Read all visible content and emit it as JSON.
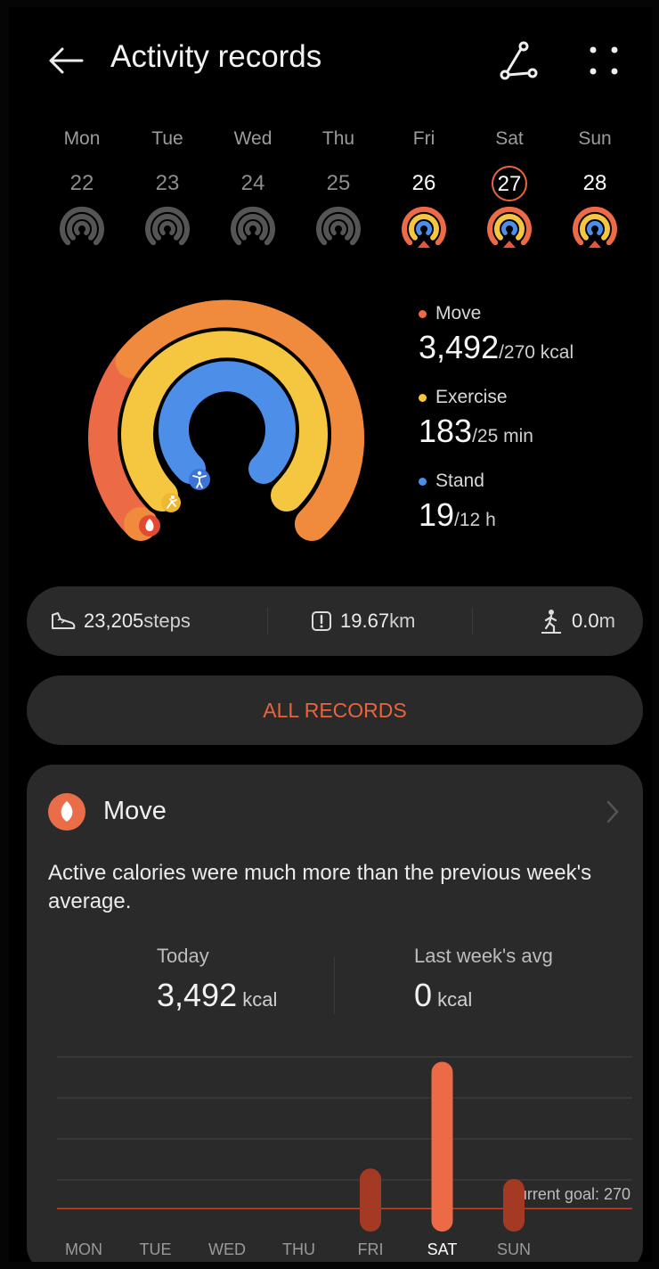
{
  "header": {
    "title": "Activity records",
    "back_icon": "back-arrow-icon",
    "route_icon": "route-icon",
    "more_icon": "more-dots-icon"
  },
  "week": [
    {
      "dow": "Mon",
      "num": "22",
      "active": false,
      "selected": false
    },
    {
      "dow": "Tue",
      "num": "23",
      "active": false,
      "selected": false
    },
    {
      "dow": "Wed",
      "num": "24",
      "active": false,
      "selected": false
    },
    {
      "dow": "Thu",
      "num": "25",
      "active": false,
      "selected": false
    },
    {
      "dow": "Fri",
      "num": "26",
      "active": true,
      "selected": false
    },
    {
      "dow": "Sat",
      "num": "27",
      "active": true,
      "selected": true
    },
    {
      "dow": "Sun",
      "num": "28",
      "active": true,
      "selected": false
    }
  ],
  "rings": {
    "move": {
      "label": "Move",
      "value": "3,492",
      "goal": "/270 kcal",
      "color": "#ec6a45"
    },
    "exercise": {
      "label": "Exercise",
      "value": "183",
      "goal": "/25 min",
      "color": "#f5c640"
    },
    "stand": {
      "label": "Stand",
      "value": "19",
      "goal": "/12 h",
      "color": "#4c8ee8"
    }
  },
  "stats": {
    "steps_value": "23,205",
    "steps_unit": " steps",
    "distance_value": "19.67",
    "distance_unit": " km",
    "climb_value": "0.0",
    "climb_unit": " m"
  },
  "all_records_label": "ALL RECORDS",
  "move_card": {
    "title": "Move",
    "message": "Active calories were much more than the previous week's average.",
    "today_label": "Today",
    "today_value": "3,492",
    "today_unit": " kcal",
    "avg_label": "Last week's avg",
    "avg_value": "0",
    "avg_unit": " kcal",
    "goal_label": "Current goal: 270"
  },
  "chart_data": {
    "type": "bar",
    "categories": [
      "MON",
      "TUE",
      "WED",
      "THU",
      "FRI",
      "SAT",
      "SUN"
    ],
    "values": [
      0,
      0,
      0,
      0,
      1150,
      3492,
      920
    ],
    "goal": 270,
    "ylim": [
      0,
      3600
    ],
    "selected": "SAT",
    "colors": {
      "bar": "#ec6a45",
      "bar_dim": "#a53a24",
      "goal_line": "#b8452c",
      "grid": "#444444"
    }
  }
}
